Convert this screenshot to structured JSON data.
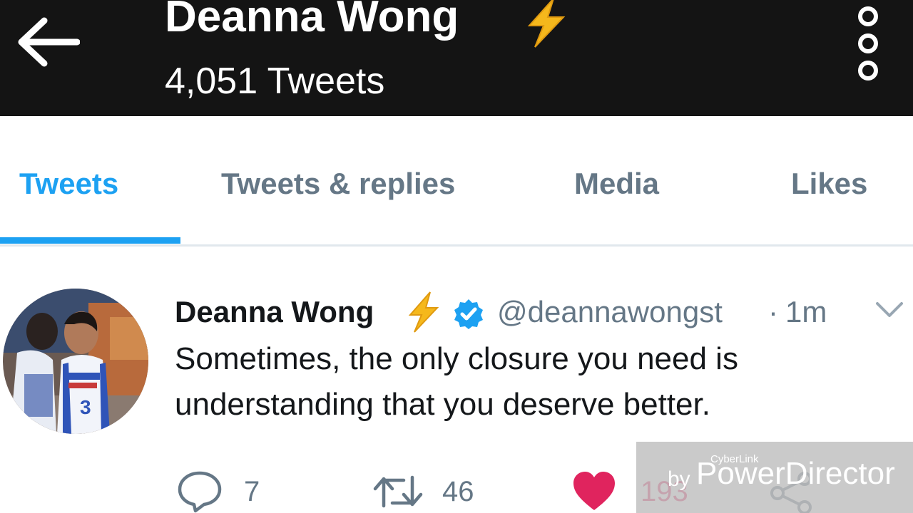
{
  "header": {
    "name": "Deanna Wong",
    "tweet_count": "4,051 Tweets",
    "back_icon": "arrow-left-icon",
    "more_icon": "vertical-dots-icon",
    "emoji": "lightning-bolt"
  },
  "tabs": [
    {
      "label": "Tweets",
      "active": true
    },
    {
      "label": "Tweets & replies",
      "active": false
    },
    {
      "label": "Media",
      "active": false
    },
    {
      "label": "Likes",
      "active": false
    }
  ],
  "tweet": {
    "name": "Deanna Wong",
    "handle": "@deannawongst",
    "separator": "·",
    "time": "1m",
    "verified": true,
    "text": "Sometimes, the only closure you need is understanding that you deserve better.",
    "actions": {
      "reply_count": "7",
      "retweet_count": "46",
      "like_count": "193",
      "liked": true
    }
  },
  "watermark": {
    "small": "CyberLink",
    "by": "by",
    "main": "PowerDirector"
  },
  "colors": {
    "header_bg": "#141414",
    "accent": "#1da1f2",
    "like": "#e0245e",
    "muted": "#657786"
  }
}
